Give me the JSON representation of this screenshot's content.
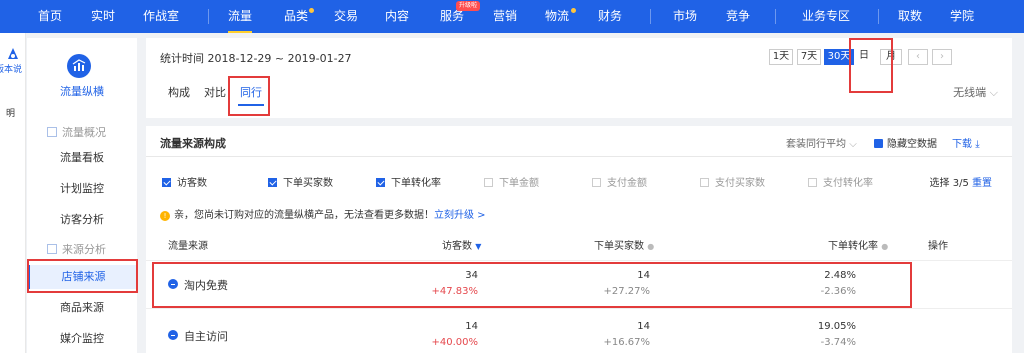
{
  "topnav": {
    "items": [
      "首页",
      "实时",
      "作战室",
      "流量",
      "品类",
      "交易",
      "内容",
      "服务",
      "营销",
      "物流",
      "财务",
      "市场",
      "竞争",
      "业务专区",
      "取数",
      "学院"
    ],
    "service_badge": "升级啦"
  },
  "leftstrip": {
    "top_label": "版本说",
    "bottom_label": "明"
  },
  "sidebar": {
    "title": "流量纵横",
    "group1": "流量概况",
    "group1_items": [
      "流量看板",
      "计划监控",
      "访客分析"
    ],
    "group2": "来源分析",
    "group2_items": [
      "店铺来源",
      "商品来源",
      "媒介监控"
    ]
  },
  "main": {
    "date_range": "统计时间 2018-12-29 ~ 2019-01-27",
    "range_buttons": [
      "1天",
      "7天",
      "30天",
      "日",
      "月",
      "‹",
      "›"
    ],
    "tabs": [
      "构成",
      "对比",
      "同行"
    ],
    "device": "无线端",
    "section_title": "流量来源构成",
    "peer_avg": "套装同行平均",
    "hide_empty": "隐藏空数据",
    "download": "下载",
    "checkboxes": [
      {
        "label": "访客数",
        "checked": true
      },
      {
        "label": "下单买家数",
        "checked": true
      },
      {
        "label": "下单转化率",
        "checked": true
      },
      {
        "label": "下单金额",
        "checked": false
      },
      {
        "label": "支付金额",
        "checked": false
      },
      {
        "label": "支付买家数",
        "checked": false
      },
      {
        "label": "支付转化率",
        "checked": false
      }
    ],
    "select_count": "选择 3/5",
    "reset": "重置",
    "notice": "亲，您尚未订购对应的流量纵横产品，无法查看更多数据！",
    "notice_link": "立刻升级 >",
    "columns": [
      "流量来源",
      "访客数",
      "下单买家数",
      "下单转化率",
      "操作"
    ],
    "rows": [
      {
        "name": "淘内免费",
        "visitors": "34",
        "visitors_change": "+47.83%",
        "buyers": "14",
        "buyers_change": "+27.27%",
        "rate": "2.48%",
        "rate_change": "-2.36%"
      },
      {
        "name": "自主访问",
        "visitors": "14",
        "visitors_change": "+40.00%",
        "buyers": "14",
        "buyers_change": "+16.67%",
        "rate": "19.05%",
        "rate_change": "-3.74%"
      }
    ]
  },
  "colors": {
    "brand": "#2062e6",
    "highlight": "#e33b3b",
    "up": "#e5484d"
  }
}
